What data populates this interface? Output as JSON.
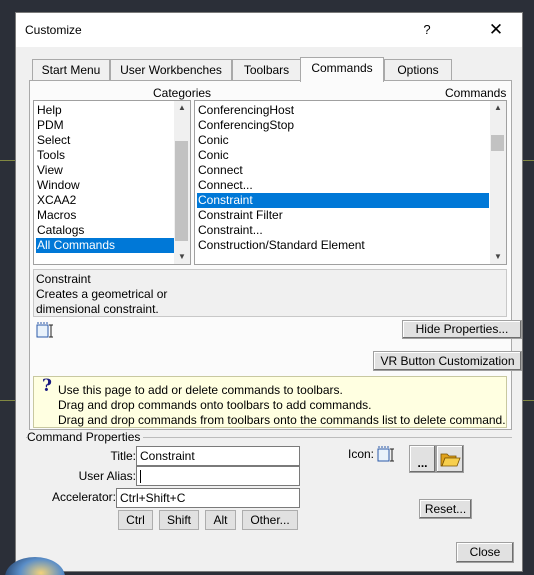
{
  "dialog": {
    "title": "Customize",
    "help_label": "?",
    "close_label": "✕"
  },
  "tabs": [
    {
      "label": "Start Menu",
      "active": false
    },
    {
      "label": "User Workbenches",
      "active": false
    },
    {
      "label": "Toolbars",
      "active": false
    },
    {
      "label": "Commands",
      "active": true
    },
    {
      "label": "Options",
      "active": false
    }
  ],
  "categories": {
    "header": "Categories",
    "items": [
      "Help",
      "PDM",
      "Select",
      "Tools",
      "View",
      "Window",
      "XCAA2",
      "Macros",
      "Catalogs",
      "All Commands"
    ],
    "selected": "All Commands"
  },
  "commands": {
    "header": "Commands",
    "items": [
      "ConferencingHost",
      "ConferencingStop",
      "Conic",
      "Conic",
      "Connect",
      "Connect...",
      "Constraint",
      "Constraint Filter",
      "Constraint...",
      "Construction/Standard Element"
    ],
    "selected": "Constraint"
  },
  "description": {
    "lines": [
      "Constraint",
      "Creates a geometrical or",
      "dimensional constraint."
    ]
  },
  "buttons": {
    "hide_properties": "Hide Properties...",
    "vr_button": "VR Button Customization",
    "ctrl": "Ctrl",
    "shift": "Shift",
    "alt": "Alt",
    "other": "Other...",
    "browse_icon": "...",
    "reset": "Reset...",
    "close": "Close"
  },
  "tip": {
    "lines": [
      "Use this page to add or delete commands to toolbars.",
      "Drag and drop commands onto toolbars to add commands.",
      "Drag and drop commands from toolbars onto the commands list to delete command."
    ]
  },
  "command_properties": {
    "group_label": "Command Properties",
    "title_label": "Title:",
    "title_value": "Constraint",
    "alias_label": "User Alias:",
    "alias_value": "",
    "accelerator_label": "Accelerator:",
    "accelerator_value": "Ctrl+Shift+C",
    "icon_label": "Icon:"
  },
  "icons": {
    "constraint": "constraint-icon",
    "open_folder": "open-folder-icon",
    "question": "question-icon"
  },
  "colors": {
    "selection": "#0078d7",
    "tip_background": "#ffffe1"
  }
}
